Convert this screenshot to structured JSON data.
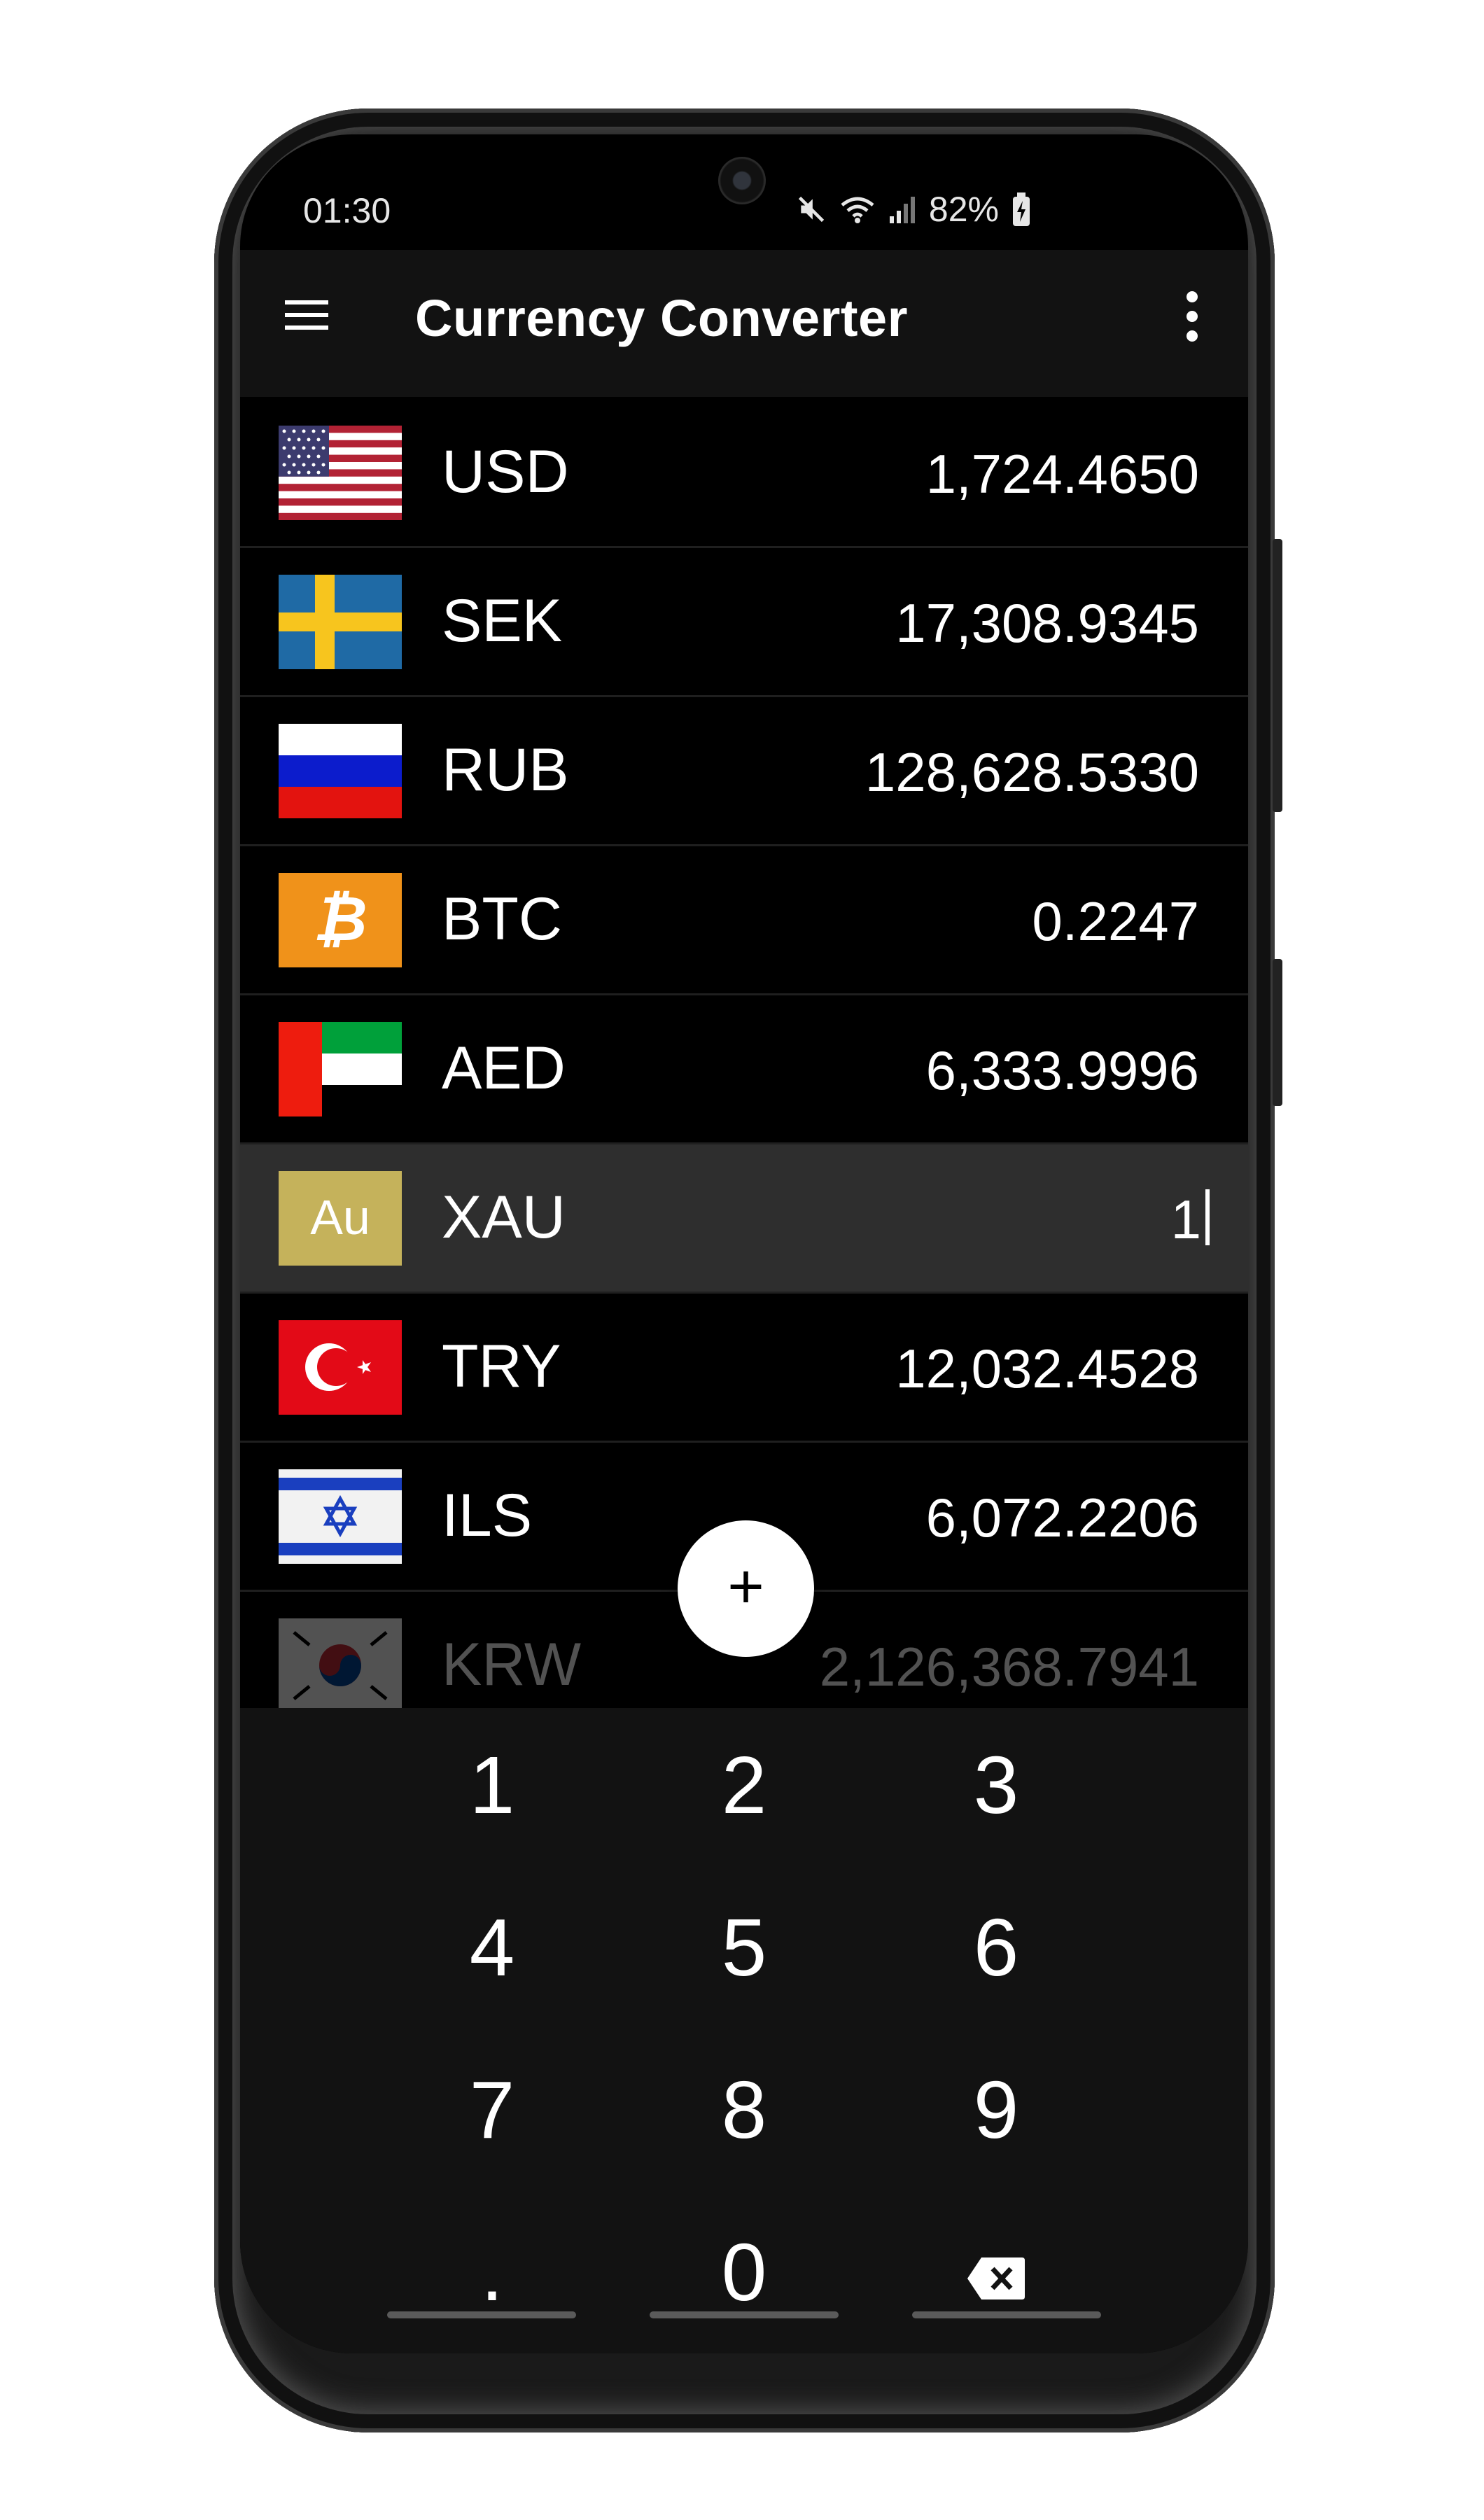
{
  "status_bar": {
    "time": "01:30",
    "battery": "82%"
  },
  "app": {
    "title": "Currency Converter"
  },
  "currencies": [
    {
      "code": "USD",
      "amount": "1,724.4650",
      "flag": "us-flag-icon"
    },
    {
      "code": "SEK",
      "amount": "17,308.9345",
      "flag": "sweden-flag-icon"
    },
    {
      "code": "RUB",
      "amount": "128,628.5330",
      "flag": "russia-flag-icon"
    },
    {
      "code": "BTC",
      "amount": "0.2247",
      "flag": "bitcoin-icon",
      "badge": "₿"
    },
    {
      "code": "AED",
      "amount": "6,333.9996",
      "flag": "uae-flag-icon"
    },
    {
      "code": "XAU",
      "amount": "1",
      "flag": "gold-au-icon",
      "badge": "Au",
      "selected": true
    },
    {
      "code": "TRY",
      "amount": "12,032.4528",
      "flag": "turkey-flag-icon"
    },
    {
      "code": "ILS",
      "amount": "6,072.2206",
      "flag": "israel-flag-icon"
    },
    {
      "code": "KRW",
      "amount": "2,126,368.7941",
      "flag": "korea-flag-icon"
    }
  ],
  "fab": {
    "label": "+"
  },
  "keypad": {
    "keys": [
      "1",
      "2",
      "3",
      "4",
      "5",
      "6",
      "7",
      "8",
      "9",
      ".",
      "0"
    ],
    "backspace_icon": "backspace-icon"
  },
  "colors": {
    "background": "#000000",
    "selected_row": "#2e2e2e",
    "gold": "#c5b25b",
    "bitcoin": "#f0921a"
  }
}
